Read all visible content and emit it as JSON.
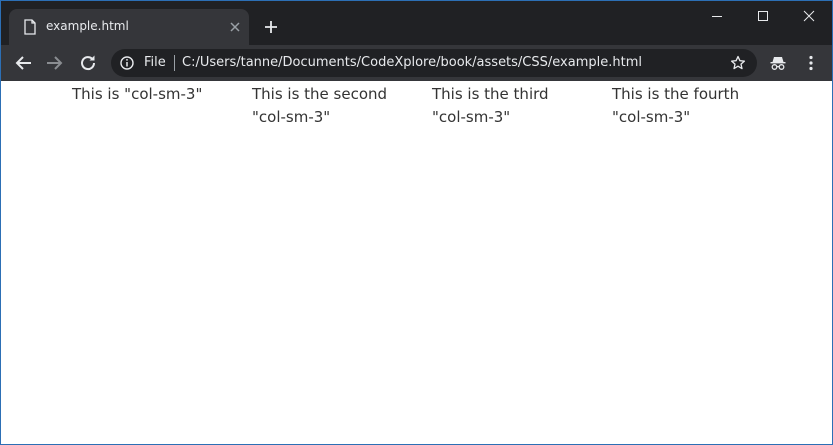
{
  "browser": {
    "tab": {
      "title": "example.html"
    },
    "address_bar": {
      "scheme_label": "File",
      "url": "C:/Users/tanne/Documents/CodeXplore/book/assets/CSS/example.html"
    },
    "icons": {
      "favicon": "page-icon",
      "tab_close": "close-icon",
      "new_tab": "plus-icon",
      "back": "arrow-left-icon",
      "forward": "arrow-right-icon",
      "reload": "reload-icon",
      "info": "info-icon",
      "bookmark": "star-icon",
      "profile": "incognito-icon",
      "menu": "kebab-menu-icon",
      "minimize": "minimize-icon",
      "maximize": "maximize-icon",
      "close": "window-close-icon"
    },
    "colors": {
      "tab_strip": "#202124",
      "toolbar": "#35363a",
      "omnibox": "#202124",
      "text_light": "#e8eaed",
      "window_border": "#2c6fb5"
    }
  },
  "page": {
    "columns": [
      {
        "text": "This is \"col-sm-3\""
      },
      {
        "text": "This is the second \"col-sm-3\""
      },
      {
        "text": "This is the third \"col-sm-3\""
      },
      {
        "text": "This is the fourth \"col-sm-3\""
      }
    ],
    "text_color": "#333333"
  }
}
